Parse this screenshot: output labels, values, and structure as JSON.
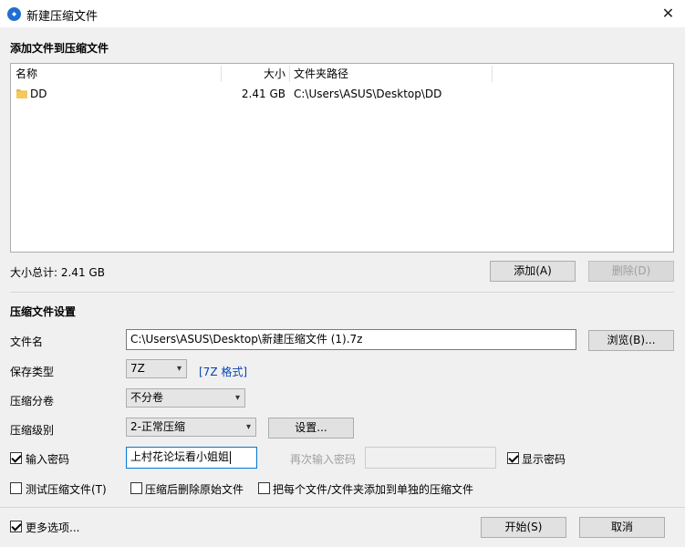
{
  "window": {
    "title": "新建压缩文件",
    "close_glyph": "✕"
  },
  "files_section": {
    "title": "添加文件到压缩文件",
    "columns": {
      "name": "名称",
      "size": "大小",
      "path": "文件夹路径"
    },
    "rows": [
      {
        "name": "DD",
        "size": "2.41 GB",
        "path": "C:\\Users\\ASUS\\Desktop\\DD"
      }
    ],
    "total": "大小总计: 2.41 GB",
    "add_label": "添加(A)",
    "delete_label": "删除(D)"
  },
  "settings": {
    "title": "压缩文件设置",
    "filename_label": "文件名",
    "filename_value": "C:\\Users\\ASUS\\Desktop\\新建压缩文件 (1).7z",
    "browse_label": "浏览(B)...",
    "save_type_label": "保存类型",
    "save_type_value": "7Z",
    "format_link": "[7Z 格式]",
    "split_label": "压缩分卷",
    "split_value": "不分卷",
    "level_label": "压缩级别",
    "level_value": "2-正常压缩",
    "settings_button": "设置...",
    "password_label": "输入密码",
    "password_checked": true,
    "password_value": "上村花论坛看小姐姐",
    "repeat_label": "再次输入密码",
    "show_password_label": "显示密码",
    "show_password_checked": true,
    "test_label": "测试压缩文件(T)",
    "delete_source_label": "压缩后删除原始文件",
    "separate_label": "把每个文件/文件夹添加到单独的压缩文件"
  },
  "footer": {
    "more_options_label": "更多选项...",
    "more_options_checked": true,
    "start_label": "开始(S)",
    "cancel_label": "取消"
  },
  "colors": {
    "accent": "#1f6fd1",
    "link": "#0645ad",
    "folder": "#e8b74a"
  }
}
